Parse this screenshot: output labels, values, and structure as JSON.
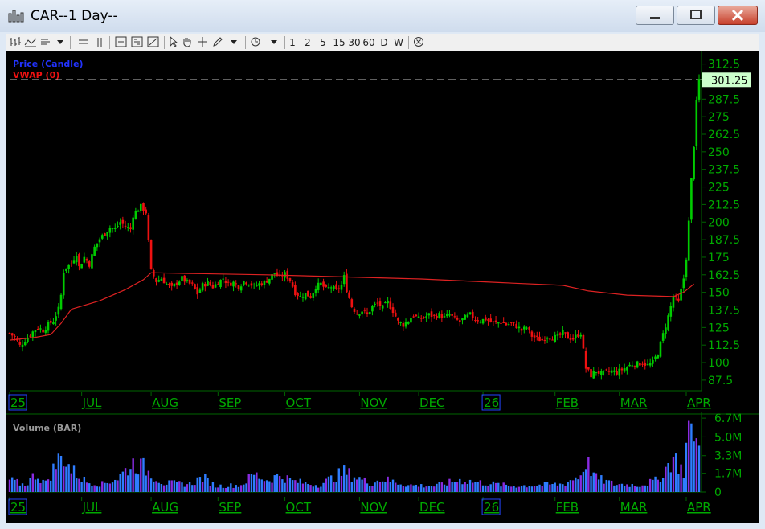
{
  "window": {
    "title": "CAR--1 Day--"
  },
  "toolbar": {
    "buttons": [
      "bar-chart",
      "line-chart",
      "candle",
      "chevron-down",
      "hline",
      "vline",
      "zoom-in",
      "zoom-out",
      "zoom-fit",
      "cursor",
      "pan",
      "crosshair",
      "draw",
      "chevron-down",
      "refresh",
      "chevron-down"
    ],
    "periods": [
      "1",
      "2",
      "5",
      "15",
      "30",
      "60",
      "D",
      "W"
    ],
    "close_icon": "x-circle"
  },
  "colors": {
    "up": "#00cc00",
    "down": "#ee1111",
    "vwap": "#dd2222",
    "price_legend": "#2233ff",
    "axis_text": "#00aa00",
    "grid": "#006600",
    "last_price_bg": "#ccffcc",
    "volume_hi": "#2e7dff",
    "volume_lo": "#8a2be2"
  },
  "chart_data": [
    {
      "type": "candlestick",
      "legend": [
        "Price (Candle)",
        "VWAP (0)"
      ],
      "last_price": "301.25",
      "ylim": [
        80,
        318
      ],
      "y_ticks": [
        "312.5",
        "301.25",
        "287.5",
        "275",
        "262.5",
        "250",
        "237.5",
        "225",
        "212.5",
        "200",
        "187.5",
        "175",
        "162.5",
        "150",
        "137.5",
        "125",
        "112.5",
        "100",
        "87.5"
      ],
      "x_labels": [
        "25",
        "JUL",
        "AUG",
        "SEP",
        "OCT",
        "NOV",
        "DEC",
        "26",
        "FEB",
        "MAR",
        "APR"
      ],
      "boxed_x_labels": [
        "25",
        "26"
      ],
      "price_path": [
        {
          "x": 0,
          "y": 121
        },
        {
          "x": 2,
          "y": 118
        },
        {
          "x": 4,
          "y": 112
        },
        {
          "x": 7,
          "y": 118
        },
        {
          "x": 9,
          "y": 122
        },
        {
          "x": 11,
          "y": 125
        },
        {
          "x": 13,
          "y": 123
        },
        {
          "x": 15,
          "y": 127
        },
        {
          "x": 17,
          "y": 130
        },
        {
          "x": 19,
          "y": 138
        },
        {
          "x": 20,
          "y": 148
        },
        {
          "x": 21,
          "y": 165
        },
        {
          "x": 22,
          "y": 168
        },
        {
          "x": 24,
          "y": 170
        },
        {
          "x": 26,
          "y": 178
        },
        {
          "x": 27,
          "y": 168
        },
        {
          "x": 29,
          "y": 175
        },
        {
          "x": 31,
          "y": 170
        },
        {
          "x": 33,
          "y": 182
        },
        {
          "x": 35,
          "y": 188
        },
        {
          "x": 37,
          "y": 192
        },
        {
          "x": 39,
          "y": 196
        },
        {
          "x": 41,
          "y": 195
        },
        {
          "x": 43,
          "y": 200
        },
        {
          "x": 45,
          "y": 197
        },
        {
          "x": 47,
          "y": 195
        },
        {
          "x": 48,
          "y": 205
        },
        {
          "x": 50,
          "y": 209
        },
        {
          "x": 51,
          "y": 211
        },
        {
          "x": 53,
          "y": 207
        },
        {
          "x": 55,
          "y": 165
        },
        {
          "x": 57,
          "y": 158
        },
        {
          "x": 59,
          "y": 160
        },
        {
          "x": 61,
          "y": 156
        },
        {
          "x": 63,
          "y": 153
        },
        {
          "x": 65,
          "y": 157
        },
        {
          "x": 67,
          "y": 160
        },
        {
          "x": 69,
          "y": 157
        },
        {
          "x": 71,
          "y": 155
        },
        {
          "x": 73,
          "y": 149
        },
        {
          "x": 75,
          "y": 155
        },
        {
          "x": 77,
          "y": 157
        },
        {
          "x": 79,
          "y": 154
        },
        {
          "x": 81,
          "y": 157
        },
        {
          "x": 83,
          "y": 160
        },
        {
          "x": 85,
          "y": 156
        },
        {
          "x": 87,
          "y": 157
        },
        {
          "x": 89,
          "y": 154
        },
        {
          "x": 91,
          "y": 158
        },
        {
          "x": 93,
          "y": 157
        },
        {
          "x": 95,
          "y": 154
        },
        {
          "x": 97,
          "y": 156
        },
        {
          "x": 99,
          "y": 157
        },
        {
          "x": 101,
          "y": 160
        },
        {
          "x": 103,
          "y": 164
        },
        {
          "x": 105,
          "y": 160
        },
        {
          "x": 107,
          "y": 163
        },
        {
          "x": 109,
          "y": 159
        },
        {
          "x": 111,
          "y": 150
        },
        {
          "x": 113,
          "y": 147
        },
        {
          "x": 115,
          "y": 149
        },
        {
          "x": 117,
          "y": 147
        },
        {
          "x": 119,
          "y": 154
        },
        {
          "x": 121,
          "y": 156
        },
        {
          "x": 123,
          "y": 152
        },
        {
          "x": 125,
          "y": 154
        },
        {
          "x": 127,
          "y": 151
        },
        {
          "x": 129,
          "y": 155
        },
        {
          "x": 130,
          "y": 161
        },
        {
          "x": 131,
          "y": 152
        },
        {
          "x": 133,
          "y": 140
        },
        {
          "x": 135,
          "y": 135
        },
        {
          "x": 137,
          "y": 137
        },
        {
          "x": 139,
          "y": 134
        },
        {
          "x": 141,
          "y": 140
        },
        {
          "x": 143,
          "y": 142
        },
        {
          "x": 145,
          "y": 139
        },
        {
          "x": 147,
          "y": 143
        },
        {
          "x": 149,
          "y": 137
        },
        {
          "x": 151,
          "y": 129
        },
        {
          "x": 153,
          "y": 127
        },
        {
          "x": 155,
          "y": 130
        },
        {
          "x": 157,
          "y": 134
        },
        {
          "x": 159,
          "y": 131
        },
        {
          "x": 161,
          "y": 132
        },
        {
          "x": 163,
          "y": 134
        },
        {
          "x": 165,
          "y": 133
        },
        {
          "x": 167,
          "y": 134
        },
        {
          "x": 169,
          "y": 132
        },
        {
          "x": 171,
          "y": 134
        },
        {
          "x": 173,
          "y": 131
        },
        {
          "x": 175,
          "y": 129
        },
        {
          "x": 177,
          "y": 132
        },
        {
          "x": 179,
          "y": 134
        },
        {
          "x": 181,
          "y": 131
        },
        {
          "x": 183,
          "y": 130
        },
        {
          "x": 185,
          "y": 131
        },
        {
          "x": 187,
          "y": 129
        },
        {
          "x": 189,
          "y": 128
        },
        {
          "x": 191,
          "y": 129
        },
        {
          "x": 193,
          "y": 127
        },
        {
          "x": 195,
          "y": 128
        },
        {
          "x": 197,
          "y": 126
        },
        {
          "x": 199,
          "y": 123
        },
        {
          "x": 201,
          "y": 125
        },
        {
          "x": 203,
          "y": 119
        },
        {
          "x": 205,
          "y": 117
        },
        {
          "x": 207,
          "y": 116
        },
        {
          "x": 209,
          "y": 119
        },
        {
          "x": 211,
          "y": 118
        },
        {
          "x": 213,
          "y": 118
        },
        {
          "x": 215,
          "y": 121
        },
        {
          "x": 217,
          "y": 118
        },
        {
          "x": 219,
          "y": 117
        },
        {
          "x": 221,
          "y": 120
        },
        {
          "x": 222,
          "y": 121
        },
        {
          "x": 224,
          "y": 96
        },
        {
          "x": 226,
          "y": 91
        },
        {
          "x": 228,
          "y": 94
        },
        {
          "x": 230,
          "y": 92
        },
        {
          "x": 232,
          "y": 93
        },
        {
          "x": 234,
          "y": 94
        },
        {
          "x": 236,
          "y": 93
        },
        {
          "x": 238,
          "y": 95
        },
        {
          "x": 240,
          "y": 97
        },
        {
          "x": 242,
          "y": 99
        },
        {
          "x": 244,
          "y": 99
        },
        {
          "x": 246,
          "y": 100
        },
        {
          "x": 248,
          "y": 98
        },
        {
          "x": 250,
          "y": 100
        },
        {
          "x": 252,
          "y": 107
        },
        {
          "x": 254,
          "y": 120
        },
        {
          "x": 256,
          "y": 133
        },
        {
          "x": 258,
          "y": 147
        },
        {
          "x": 260,
          "y": 143
        },
        {
          "x": 262,
          "y": 160
        },
        {
          "x": 263,
          "y": 175
        },
        {
          "x": 264,
          "y": 200
        },
        {
          "x": 265,
          "y": 230
        },
        {
          "x": 266,
          "y": 255
        },
        {
          "x": 267,
          "y": 285
        },
        {
          "x": 268,
          "y": 301.25
        }
      ],
      "vwap_path": [
        {
          "x": 0,
          "y": 116
        },
        {
          "x": 10,
          "y": 118
        },
        {
          "x": 16,
          "y": 120
        },
        {
          "x": 20,
          "y": 128
        },
        {
          "x": 24,
          "y": 138
        },
        {
          "x": 35,
          "y": 144
        },
        {
          "x": 45,
          "y": 152
        },
        {
          "x": 52,
          "y": 159
        },
        {
          "x": 55,
          "y": 164
        },
        {
          "x": 70,
          "y": 163.5
        },
        {
          "x": 100,
          "y": 162.5
        },
        {
          "x": 130,
          "y": 161
        },
        {
          "x": 160,
          "y": 159.5
        },
        {
          "x": 190,
          "y": 157
        },
        {
          "x": 215,
          "y": 155
        },
        {
          "x": 225,
          "y": 151
        },
        {
          "x": 240,
          "y": 148
        },
        {
          "x": 258,
          "y": 147
        },
        {
          "x": 262,
          "y": 150
        },
        {
          "x": 266,
          "y": 156
        }
      ],
      "x_label_positions": [
        0,
        28,
        55,
        81,
        107,
        136,
        159,
        184,
        212,
        237,
        263
      ]
    },
    {
      "type": "bar",
      "legend": [
        "Volume (BAR)"
      ],
      "ylim": [
        0,
        7.0
      ],
      "y_ticks": [
        "6.7M",
        "5.0M",
        "3.3M",
        "1.7M",
        "0"
      ],
      "y_tick_values": [
        6.7,
        5.0,
        3.3,
        1.7,
        0
      ],
      "x_labels": [
        "25",
        "JUL",
        "AUG",
        "SEP",
        "OCT",
        "NOV",
        "DEC",
        "26",
        "FEB",
        "MAR",
        "APR"
      ],
      "boxed_x_labels": [
        "25",
        "26"
      ],
      "volume_path": [
        {
          "x": 0,
          "y": 1.2
        },
        {
          "x": 6,
          "y": 0.7
        },
        {
          "x": 10,
          "y": 1.8
        },
        {
          "x": 14,
          "y": 0.9
        },
        {
          "x": 19,
          "y": 3.2
        },
        {
          "x": 21,
          "y": 3.6
        },
        {
          "x": 24,
          "y": 2.2
        },
        {
          "x": 30,
          "y": 1.0
        },
        {
          "x": 36,
          "y": 0.8
        },
        {
          "x": 42,
          "y": 1.4
        },
        {
          "x": 48,
          "y": 2.9
        },
        {
          "x": 52,
          "y": 2.5
        },
        {
          "x": 55,
          "y": 1.8
        },
        {
          "x": 60,
          "y": 0.9
        },
        {
          "x": 70,
          "y": 0.8
        },
        {
          "x": 75,
          "y": 1.5
        },
        {
          "x": 80,
          "y": 0.6
        },
        {
          "x": 90,
          "y": 0.7
        },
        {
          "x": 95,
          "y": 1.8
        },
        {
          "x": 100,
          "y": 1.2
        },
        {
          "x": 105,
          "y": 1.7
        },
        {
          "x": 110,
          "y": 1.1
        },
        {
          "x": 120,
          "y": 0.7
        },
        {
          "x": 130,
          "y": 2.0
        },
        {
          "x": 133,
          "y": 1.7
        },
        {
          "x": 140,
          "y": 0.9
        },
        {
          "x": 145,
          "y": 1.3
        },
        {
          "x": 155,
          "y": 0.7
        },
        {
          "x": 165,
          "y": 0.6
        },
        {
          "x": 175,
          "y": 1.2
        },
        {
          "x": 185,
          "y": 0.9
        },
        {
          "x": 195,
          "y": 0.6
        },
        {
          "x": 205,
          "y": 0.7
        },
        {
          "x": 215,
          "y": 0.8
        },
        {
          "x": 222,
          "y": 1.7
        },
        {
          "x": 224,
          "y": 3.2
        },
        {
          "x": 228,
          "y": 1.4
        },
        {
          "x": 235,
          "y": 0.8
        },
        {
          "x": 245,
          "y": 0.7
        },
        {
          "x": 252,
          "y": 1.2
        },
        {
          "x": 258,
          "y": 3.5
        },
        {
          "x": 262,
          "y": 2.0
        },
        {
          "x": 263,
          "y": 4.5
        },
        {
          "x": 264,
          "y": 6.6
        },
        {
          "x": 265,
          "y": 5.2
        },
        {
          "x": 266,
          "y": 6.8
        },
        {
          "x": 267,
          "y": 5.0
        },
        {
          "x": 268,
          "y": 4.2
        }
      ]
    }
  ]
}
